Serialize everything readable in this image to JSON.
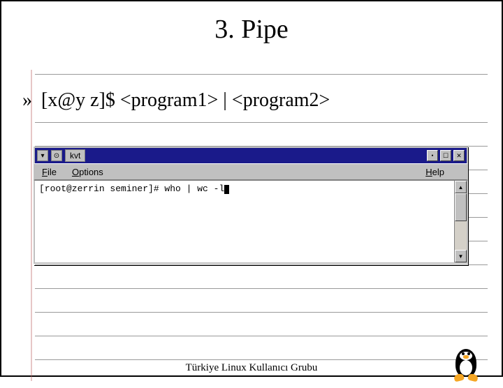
{
  "title": "3. Pipe",
  "bullet": {
    "marker": "»",
    "text": "[x@y z]$ <program1> | <program2>"
  },
  "terminal": {
    "window_title": "kvt",
    "menus": {
      "file": "File",
      "options": "Options",
      "help": "Help"
    },
    "prompt_line": "[root@zerrin seminer]# who | wc -l"
  },
  "footer": "Türkiye Linux Kullanıcı Grubu",
  "mascot": "tux-penguin"
}
